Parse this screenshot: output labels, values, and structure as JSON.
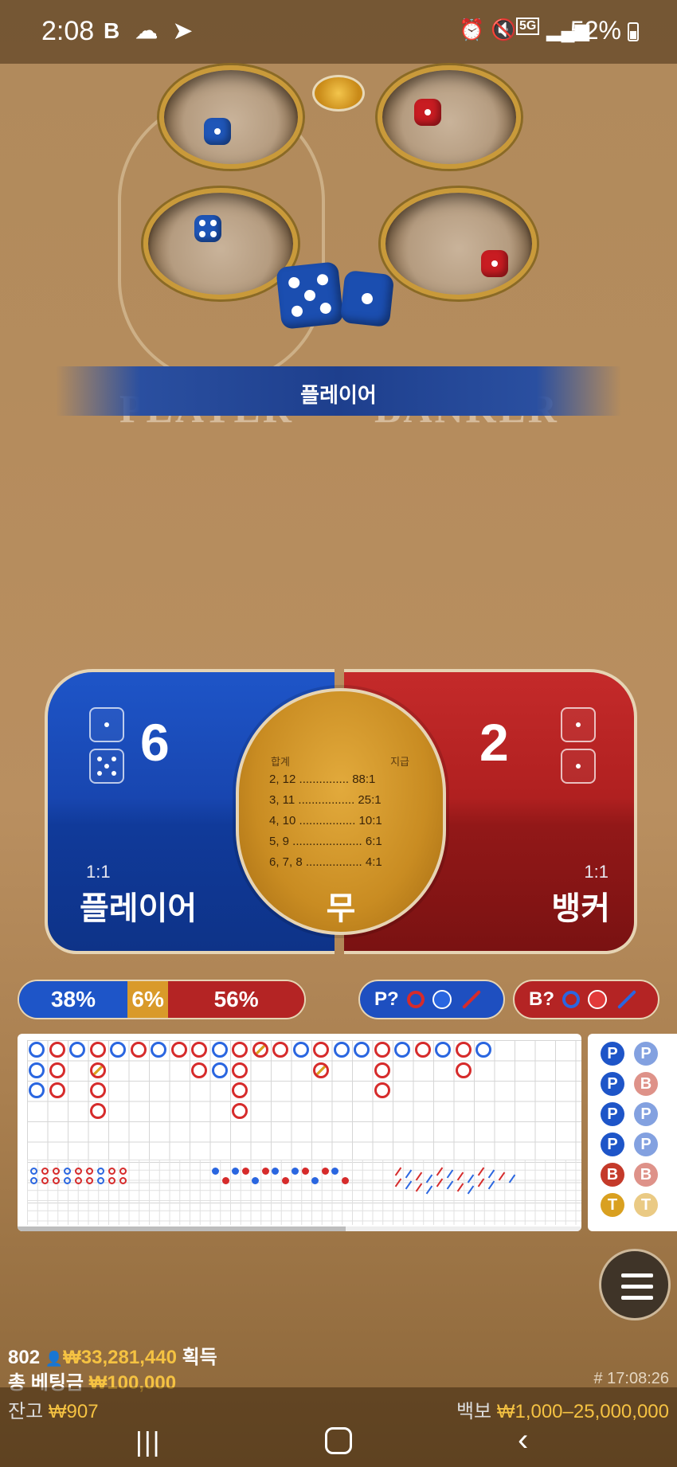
{
  "status_bar": {
    "time": "2:08",
    "left_icons": "B ☁ ➤",
    "battery": "52%",
    "network": "5G"
  },
  "table": {
    "result_banner": "플레이어",
    "player_word": "PLAYER",
    "banker_word": "BANKER"
  },
  "bet_panel": {
    "player": {
      "score": "6",
      "odds": "1:1",
      "label": "플레이어",
      "dice": [
        1,
        5
      ]
    },
    "banker": {
      "score": "2",
      "odds": "1:1",
      "label": "뱅커",
      "dice": [
        1,
        1
      ]
    },
    "tie": {
      "header_left": "합계",
      "header_right": "지급",
      "rows": [
        "2, 12 ............... 88:1",
        "3, 11 ................. 25:1",
        "4, 10 ................. 10:1",
        "5, 9 ..................... 6:1",
        "6, 7, 8 ................. 4:1"
      ],
      "label": "무"
    }
  },
  "stats": {
    "player_pct": "38%",
    "tie_pct": "6%",
    "banker_pct": "56%",
    "player_fraction": 0.38,
    "tie_fraction": 0.06,
    "banker_fraction": 0.56,
    "player_predict_label": "P?",
    "banker_predict_label": "B?"
  },
  "side_board": [
    "P",
    "P",
    "P",
    "B",
    "P",
    "P",
    "P",
    "P",
    "B",
    "B",
    "T",
    "T"
  ],
  "footer": {
    "players": "802",
    "won_amount": "₩33,281,440",
    "won_label": "획득",
    "total_bet_label": "총 베팅금",
    "total_bet": "₩100,000",
    "balance_label": "잔고",
    "balance": "₩907",
    "timestamp": "# 17:08:26",
    "limit_label": "백보",
    "limit": "₩1,000–25,000,000"
  },
  "colors": {
    "player_blue": "#1e55c8",
    "banker_red": "#c42a2a",
    "tie_gold": "#d99a2a",
    "accent_gold": "#f5c242"
  }
}
